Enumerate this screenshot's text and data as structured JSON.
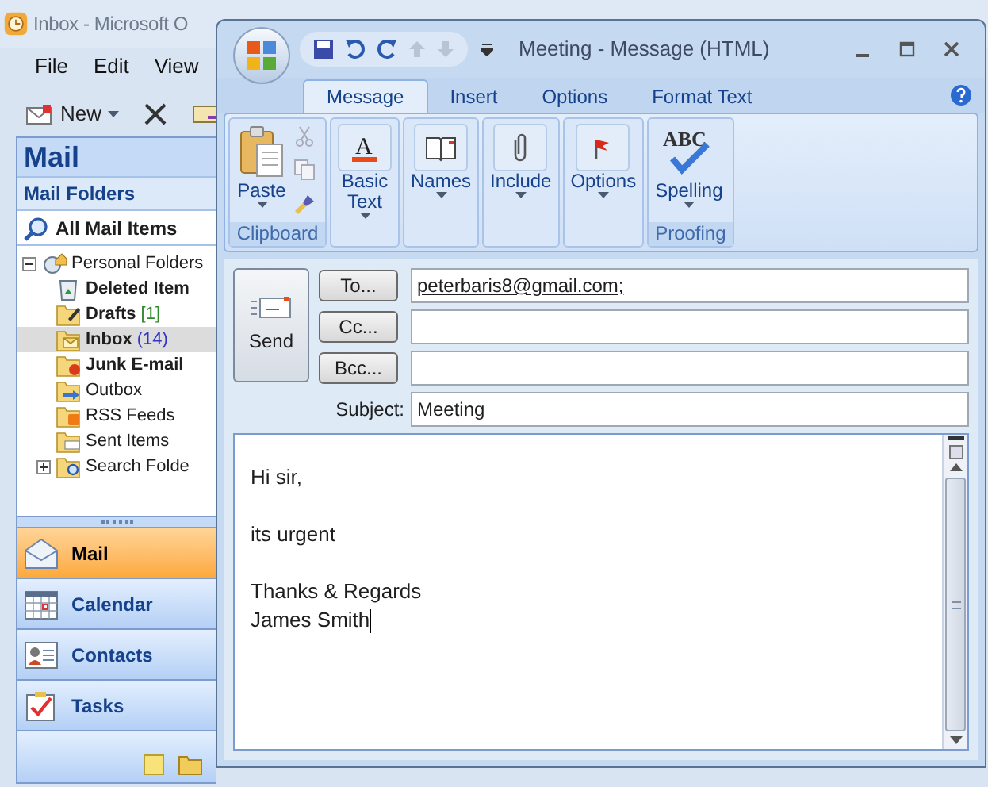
{
  "outlook": {
    "title": "Inbox - Microsoft O",
    "menu": [
      "File",
      "Edit",
      "View"
    ],
    "new_label": "New",
    "pane_title": "Mail",
    "section": "Mail Folders",
    "all_items": "All Mail Items",
    "folders": [
      {
        "name": "Personal Folders",
        "kind": "personal",
        "expanded": true,
        "bold": false,
        "selected": false,
        "children": [
          {
            "name": "Deleted Item",
            "kind": "deleted",
            "bold": true,
            "selected": false
          },
          {
            "name": "Drafts",
            "kind": "drafts",
            "bold": true,
            "selected": false,
            "count": "[1]",
            "color": "#2e8b2e"
          },
          {
            "name": "Inbox",
            "kind": "inbox",
            "bold": true,
            "selected": true,
            "count": "(14)",
            "color": "#3333cc"
          },
          {
            "name": "Junk E-mail",
            "kind": "junk",
            "bold": true,
            "selected": false
          },
          {
            "name": "Outbox",
            "kind": "outbox",
            "bold": false,
            "selected": false
          },
          {
            "name": "RSS Feeds",
            "kind": "rss",
            "bold": false,
            "selected": false
          },
          {
            "name": "Sent Items",
            "kind": "sent",
            "bold": false,
            "selected": false
          },
          {
            "name": "Search Folde",
            "kind": "search",
            "bold": false,
            "selected": false,
            "expanded": false
          }
        ]
      }
    ],
    "nav_buttons": [
      {
        "label": "Mail",
        "kind": "mail",
        "selected": true
      },
      {
        "label": "Calendar",
        "kind": "calendar",
        "selected": false
      },
      {
        "label": "Contacts",
        "kind": "contacts",
        "selected": false
      },
      {
        "label": "Tasks",
        "kind": "tasks",
        "selected": false
      }
    ]
  },
  "compose": {
    "title": "Meeting - Message (HTML)",
    "tabs": [
      {
        "label": "Message",
        "selected": true
      },
      {
        "label": "Insert",
        "selected": false
      },
      {
        "label": "Options",
        "selected": false
      },
      {
        "label": "Format Text",
        "selected": false
      }
    ],
    "groups": [
      {
        "label": "Clipboard",
        "buttons": [
          {
            "label": "Paste",
            "kind": "paste"
          }
        ]
      },
      {
        "buttons": [
          {
            "label": "Basic Text",
            "kind": "text",
            "icon_text": "A"
          }
        ]
      },
      {
        "buttons": [
          {
            "label": "Names",
            "kind": "names"
          }
        ]
      },
      {
        "buttons": [
          {
            "label": "Include",
            "kind": "include"
          }
        ]
      },
      {
        "buttons": [
          {
            "label": "Options",
            "kind": "options"
          }
        ]
      },
      {
        "label": "Proofing",
        "buttons": [
          {
            "label": "Spelling",
            "kind": "spelling",
            "icon_text": "ABC"
          }
        ]
      }
    ],
    "send": "Send",
    "fields": [
      {
        "button": "To...",
        "value": "peterbaris8@gmail.com;"
      },
      {
        "button": "Cc..."
      },
      {
        "button": "Bcc..."
      },
      {
        "label": "Subject:",
        "value": "Meeting"
      }
    ],
    "body": [
      {
        "lines": [
          "Hi sir,"
        ]
      },
      {
        "lines": [
          "its urgent"
        ]
      },
      {
        "lines": [
          "Thanks & Regards",
          "James Smith"
        ]
      }
    ]
  }
}
